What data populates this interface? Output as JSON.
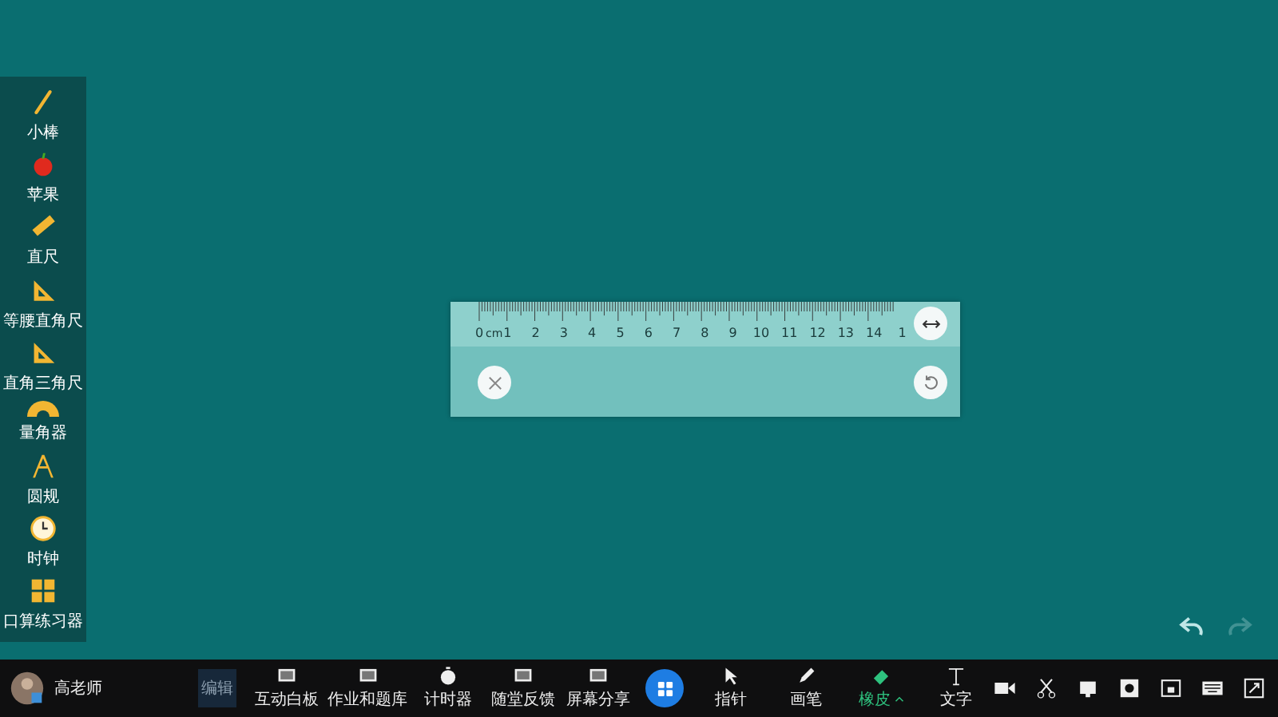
{
  "sidebar": {
    "items": [
      {
        "kind": "stick",
        "label": "小棒"
      },
      {
        "kind": "apple",
        "label": "苹果"
      },
      {
        "kind": "ruler",
        "label": "直尺"
      },
      {
        "kind": "isosceles",
        "label": "等腰直角尺"
      },
      {
        "kind": "triangle",
        "label": "直角三角尺"
      },
      {
        "kind": "protractor",
        "label": "量角器"
      },
      {
        "kind": "compass",
        "label": "圆规"
      },
      {
        "kind": "clock",
        "label": "时钟"
      },
      {
        "kind": "grid",
        "label": "口算练习器"
      }
    ]
  },
  "ruler": {
    "unit": "cm",
    "labels": [
      "0",
      "1",
      "2",
      "3",
      "4",
      "5",
      "6",
      "7",
      "8",
      "9",
      "10",
      "11",
      "12",
      "13",
      "14",
      "1"
    ]
  },
  "history": {
    "undo_disabled": false,
    "redo_disabled": true
  },
  "toolbar": {
    "user": "高老师",
    "edit": "编辑",
    "items": [
      {
        "kind": "board",
        "label": "互动白板",
        "selected": false
      },
      {
        "kind": "library",
        "label": "作业和题库",
        "selected": false
      },
      {
        "kind": "timer",
        "label": "计时器",
        "selected": false
      },
      {
        "kind": "feedback",
        "label": "随堂反馈",
        "selected": false
      },
      {
        "kind": "share",
        "label": "屏幕分享",
        "selected": false
      },
      {
        "kind": "apps",
        "selected": false
      },
      {
        "kind": "pointer",
        "label": "指针",
        "selected": false
      },
      {
        "kind": "pen",
        "label": "画笔",
        "selected": false
      },
      {
        "kind": "eraser",
        "label": "橡皮",
        "selected": true
      },
      {
        "kind": "text",
        "label": "文字",
        "selected": false
      }
    ]
  }
}
